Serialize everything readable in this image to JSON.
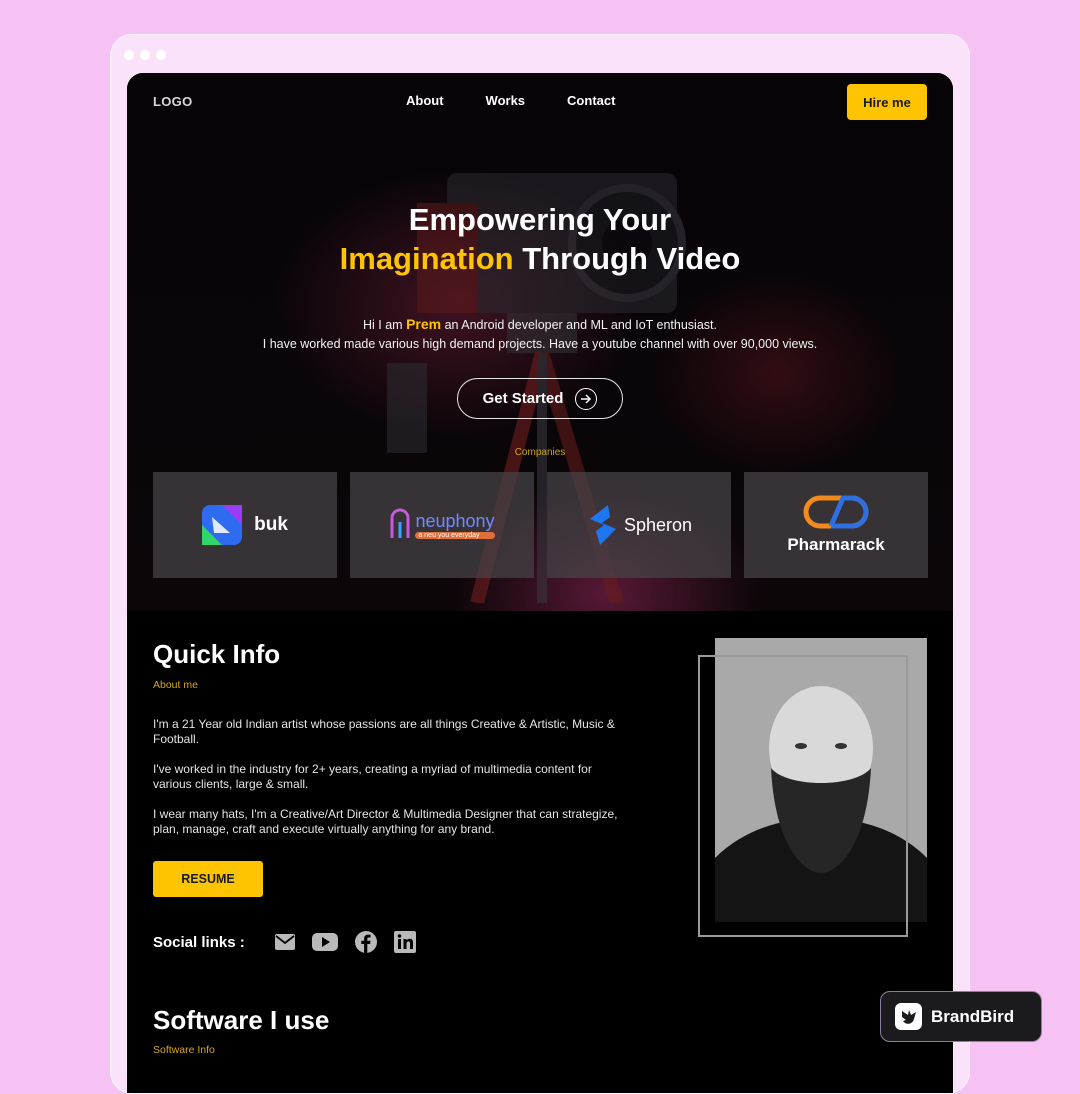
{
  "nav": {
    "logo": "LOGO",
    "links": [
      "About",
      "Works",
      "Contact"
    ],
    "hire_label": "Hire me"
  },
  "hero": {
    "title_line1": "Empowering Your",
    "title_highlight": "Imagination",
    "title_line2_rest": " Through Video",
    "intro_prefix": "Hi I am ",
    "intro_name": "Prem",
    "intro_suffix": " an Android developer and ML and IoT enthusiast.",
    "intro_line2": "I have worked made various high demand projects. Have a youtube channel with over 90,000 views.",
    "cta_label": "Get Started",
    "companies_label": "Companies",
    "companies": [
      {
        "name": "buk",
        "icon": "buk-logo-icon"
      },
      {
        "name": "neuphony",
        "tagline": "a neu you everyday",
        "icon": "neuphony-logo-icon"
      },
      {
        "name": "Spheron",
        "icon": "spheron-logo-icon"
      },
      {
        "name": "Pharmarack",
        "icon": "pharmarack-logo-icon"
      }
    ]
  },
  "quick_info": {
    "title": "Quick Info",
    "subtitle": "About me",
    "paragraphs": [
      "I'm a 21 Year old Indian artist whose passions are all things Creative & Artistic, Music & Football.",
      "I've worked in the industry for 2+ years, creating a myriad of multimedia content for various clients, large & small.",
      "I wear many hats, I'm a Creative/Art Director & Multimedia Designer that can strategize, plan, manage, craft and execute virtually anything for any brand."
    ],
    "resume_label": "RESUME",
    "social_label": "Social links :",
    "social_icons": [
      "mail-icon",
      "youtube-icon",
      "facebook-icon",
      "linkedin-icon"
    ]
  },
  "software": {
    "title": "Software I use",
    "subtitle": "Software Info"
  },
  "badge": {
    "label": "BrandBird"
  },
  "colors": {
    "accent": "#ffc400",
    "background": "#f6c2f4",
    "screen": "#000000"
  }
}
